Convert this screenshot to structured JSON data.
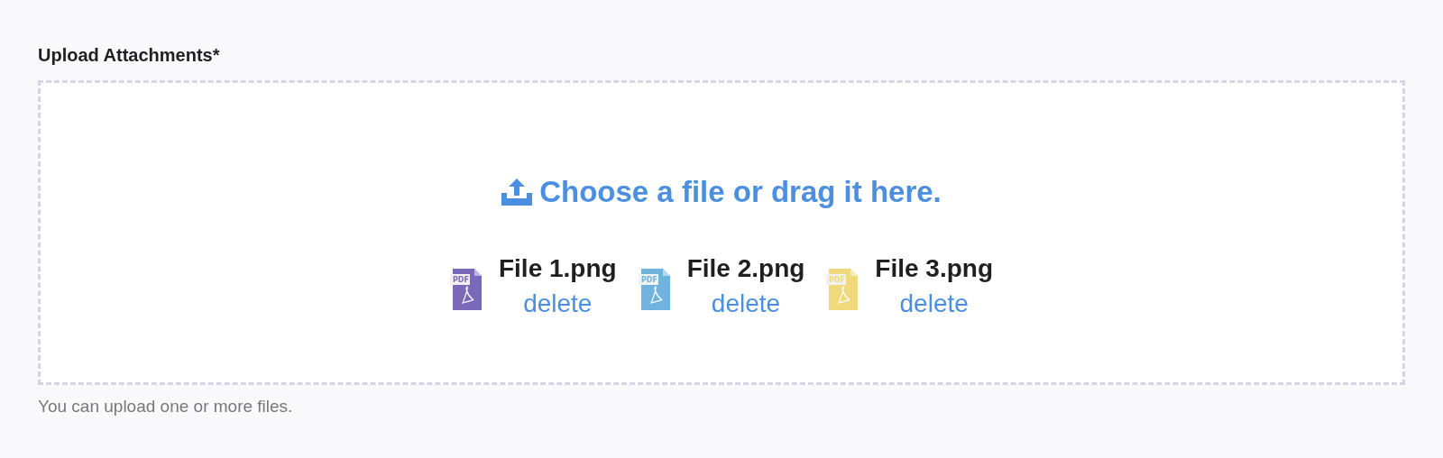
{
  "label": "Upload Attachments*",
  "dropzone": {
    "prompt": "Choose a file or drag it here."
  },
  "files": [
    {
      "name": "File 1.png",
      "icon_text": "PDF",
      "color": "#7a68b8",
      "action": "delete"
    },
    {
      "name": "File 2.png",
      "icon_text": "PDF",
      "color": "#6fb3df",
      "action": "delete"
    },
    {
      "name": "File 3.png",
      "icon_text": "PDF",
      "color": "#efd97a",
      "action": "delete"
    }
  ],
  "help": "You can upload one or more files."
}
